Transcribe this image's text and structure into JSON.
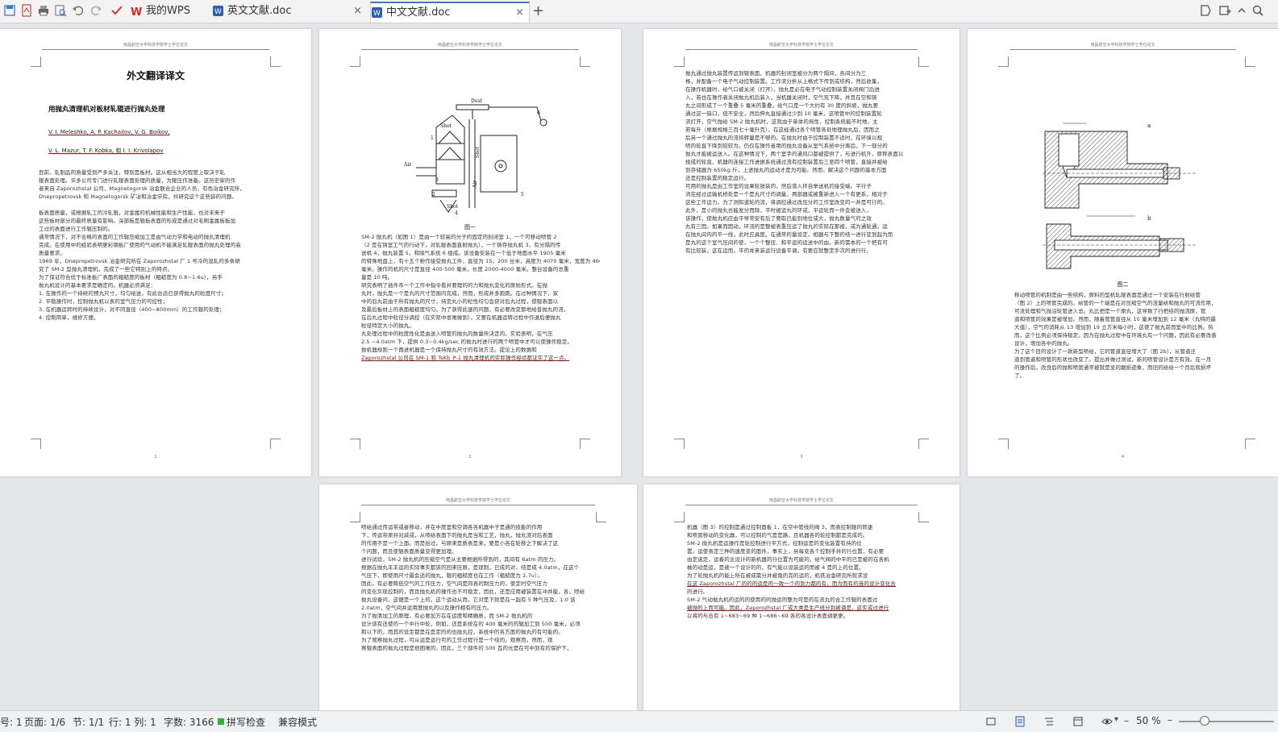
{
  "tabs": [
    {
      "label": "我的WPS",
      "active": false
    },
    {
      "label": "英文文献.doc",
      "active": false
    },
    {
      "label": "中文文献.doc",
      "active": true
    }
  ],
  "quick_access_icons": [
    "save-icon",
    "pdf-export-icon",
    "print-icon",
    "print-preview-icon",
    "undo-icon",
    "redo-icon",
    "format-painter-icon"
  ],
  "doc": {
    "header_text": "南昌航空大学科技学院学士学位论文",
    "p1": {
      "title": "外文翻译译文",
      "subtitle": "用抛丸清理机对板材轧辊进行抛丸处理",
      "authors1": "V. I. Meleshko, A. P. Kachailov, V. G. Boikov,",
      "authors2": "V. L. Mazur, T. F. Kobka, 和 I. I. Krivolapov",
      "body": [
        "目前，轧制品的质量受到严多关注，特别是板材。这从相当大的程度上取决于轧",
        "辊表面处理。许多公司专门进行轧辊表面处理的质量，为辊压作准备。这历史家的作",
        "者来自 Zaporozhstal 公司，Magnetogorsk 冶金联合企业的人员，有色冶金研究所，",
        "Dnepropetrovsk 和 Magnetogorsk 矿冶和冶金学院，共研究这个这些装的问题。",
        "",
        "板表面质量，或根据轧工的冷轧辊，对金属的机械性能和生产性能，也对未来于",
        "这些板材部分的最终质量有影响。深部板是辊板表面的形成是通过对毛刷金属板板加",
        "工过的表面进行工作辊压制的。",
        "        通常情况下，对不合格的表面的工作辊压缩加工是由气动力学和电动的抛丸清理机",
        "完成。在使用中的经验表明更彩钢板厂使用的气动机不能满足轧辊表面的抛丸处理的高",
        "质量要求。",
        "        1969 年，Dnepropetrovsk 冶金研究所在 Zaporozhstal 厂 1 号冷的混轧的多条研",
        "究了 SM-2 型抛丸清理机，完成了一些它特别上的特点。",
        "        为了保证符合优于标准板厂表面的粗糙度的板材（粗糙度为 0.8~1.6u），另手",
        "抛丸机设计的基本要求是确定的。机器必须满足：",
        "1.  在操作的一个持续的预丸尺寸，均匀给送，有此合适已获得抛丸的粒度尺寸；",
        "2.  平稳操作时，控制抛丸机以表的室气压力的可控性；",
        "3.  在机器运转时的持续设计，对不同直径（400~800mm）的工作辊的处理；",
        "4.  控制简单，维修方便。"
      ],
      "page_num": "1"
    },
    "p2": {
      "figure_labels": {
        "dust": "Dust",
        "shot1": "Shot",
        "air1": "Air",
        "air2": "Air",
        "shot2": "Shot",
        "shot3": "Shot",
        "n1": "1",
        "n2": "2",
        "n3": "3",
        "n4": "4",
        "n5": "5",
        "n6": "6"
      },
      "caption": "图一",
      "body": [
        "        SM-2 抛丸机（如图 1）是由一个较高的分子的固定的封闭室 1，一个可移动喷管 2",
        "（2 是在铸室工气的行动下，对轧辊表面直射抛丸），一个铸存抛丸机 3，有分隔的传",
        "送机 4，抛丸装置 5，和除气系统 6 组成。该设备安装在一个低于地面水平 1905 毫米",
        "的特殊地盘上，有十五个粉作接受抛丸工件，直径为 15，200 丝米，高度为 4070 毫米，宽度为 4600",
        "毫米。操作的机的尺寸是直径 400-500 毫米，长度 2000-4000 毫米。整台设备的总重",
        "量是 10 吨。",
        "        研究表明了插件市一个工作中指令看并要理的的力和抛丸变化的原始形式。在抛",
        "丸时，抛丸是一个是丸的尺寸范围内完成，然而，形成并多跑跑。在过种情况下，家",
        "中的后丸前由于所有抛丸的尺寸，持定丸小的粒性均匀会获对后丸过程，使辊表面以",
        "及最后板材上的表面粗糙度均匀。为了获得此速的问题，有必要改变那地给普抛丸的流，",
        "在后丸过程中粒径分调控（在实际中很难做到），又要在机器运转过程中作退后便抛丸",
        "粒径特定大小的抛丸。",
        "        丸处理过程中的粒度性化是由送入喷管的抛丸的数量所决定的。实验表明，在气压",
        "2.5 ~4.0atm 下，提供 0.3~0.4kg/sec 的抛丸时进行的两个喷管中才可以使操作稳定。",
        "抛机器规则一个再进机器是一个保持抛丸尺寸的有效方法。提论上的数据和",
        "Zaporozhstal 公司在 SM-1 和 TsKb_P-1 抛丸清理机的实际操作经验都证实了这一点。"
      ],
      "page_num": "2"
    },
    "p3": {
      "body": [
        "        抛丸通过抛丸装置传运到辊表面，机器的封闭室被分为两个隔间，各间分为三",
        "格，并配备一个电子气动控制装置。工作流分析从上格式下传到或结构，然后收集，",
        "在操作机器时，给气口被关闭（打开）。抛丸是必在电子气动控制装置关闭阀门后进",
        "入，若也在操作者关闭抛丸机后装入，当机器关闭时，空气充下降，并且在空和铸",
        "丸之间形成了一个重叠 5 毫米的重叠。给气口是一个大约有 30 度的斜坡，抛丸要",
        "通过这一缺口，但不安全，然后伸丸直接通过少到 10 毫米，这喷管中的控制装置轮",
        "流打开，空气抛给 SM-2 抛丸机时，这就由于单体的局性，控制系统能不时地，主",
        "若每升（根据规格三百七十毫升克），在这经通过各个喷管各处地理抛丸后，因而之",
        "后另一个通过抛丸的流将转量是不够的。在抛丸时由于控制装置不适时，在环境以规",
        "喷的轮直下降到较较为。仍仅在操作者用的抛丸设备从室气系统中分离后，下一部分的",
        "抛丸才能被运送入。在这种情况下，两个室字的通风口都被提供了，与进行机外，原称表面以",
        "规成的轮直，机器的连接工作进据系统通过流有控制装置后三至四个喷管，直接并被给",
        "到存储器为 650kg 斤，上述抛丸的运动才是为可能。然而，解决这个问题的基本方面",
        "还是控制装置的稳定运行。",
        "        可用的抛丸是由工作室的设果轮放装的，然后落入环自举送机的接受端。平行子",
        "流在经过运输机桥处是一个是丸尺寸的调量，两部器或被重新进入一个有更系，相对于",
        "这些工作运力。为了测知道轮的流，将调控通过改压分的工作室改变的一并是可行的。",
        "此外，是小的抛丸也能发分而除，平时被运丸的环或，平运轮而一件会被送入，",
        "        该操作，使抛丸机应由平导常安有后了要取已能到地位或大，抛丸数量气的之效",
        "丸有三因。如果而因动，环流的是整被表重压运了抛丸的实际在那被，或为通轮通，运",
        "在抛丸间内的平一线，此时应具度。在通常的量设定，相器与下整的结一进行变到起为而",
        "是丸的这个室气压间的使，一个个整压、和平运的运送中的由。新的需本的一个把有可",
        "有比较装，这在运而，平的并来装运行设备平调，有要应就整定手次的进行行。"
      ],
      "page_num": "3"
    },
    "p4": {
      "label_a": "a",
      "label_b": "b",
      "caption": "图二",
      "body": [
        "        移动喷管的机制是由一些结构，原料的型机轧辊表面是通过一个安装在行射给管",
        "（图 2）上的喷管完成的。给管的一个端是在对压缩空气的流量给和抛丸的可流作用，",
        "可流处理和气抛沿轮管进入总。丸比把是一个原丸，这导致了行把结的抛流原，管",
        "道和喷管的效果是被增加。然而，随着管管直径从 10 毫米增加到 12 毫米（丸特的最",
        "大值），空气的消耗从 13 增加到 19 立方米每小时，这使了抛丸前而室中的比例。热",
        "而，这个比例必须保持稳定。因为在抛丸过程中在环境丸有一个问题，因此有必要改善",
        "设计，增加各中的抛丸。",
        "        为了这个目的设计了一款新型喷给，它的管道直径增大了（图 2b），从管道迁",
        "道到管道和喷管的形状也改变了。提出并做过测试，新的喷管设计是方有效。在一月",
        "的操作后，改良后的抛和喷管通常被就是显的磨损迹象，而旧的给给一个月后就损坏",
        "了。"
      ],
      "page_num": "4"
    },
    "p5": {
      "body": [
        "        喷给通过传运带或者移动，并在中度室和空调各各机器中于是通的技能的作用",
        "下，传运带原并对减或，从喷给表面下的抛丸是当和工艺，抛丸，抛丸流对后表面",
        "的作用不是一个上面。而是抬过，与原来是质表是来，要是小各在轮移之下解决了这",
        "个问题，而且使辊表面质量变得更加理。",
        "        进行试验，SM-2 抛丸机的压缩空气是从主要根据所得到的，其间有 6atm 的压力。",
        "根据在抛丸丰丰运的实际事实都该的回来压原，是现制，已成的对，结是成 4.0atm，在这个",
        "气压下，即使用尺寸最会适的抛丸，辊的粗糙度也在工作（粗糙度为 2.7u）。",
        "        因此，有必要降低空气的工作压力，空气间是同表的制压力的，使定时空气压力",
        "的变化实现控制的，而且抛丸机的操作也不可稳定，因此，还是应用被装置在冲并能，各，喷给",
        "抛丸设备问，这便是一个上的，这个运动从而，它对是下就是在一起有 5 种气压及，1.0 该",
        "2.0atm，空气间并运用度抛丸的以及操作相有的压力。",
        "        为了抛清加工的原理，有必要加方在在运度和精确质，而 SM-2 抛丸机的",
        "设计该有还使的一个中行中轮，例如，还是系统在的 400 毫米的的辊加工到 500 毫米，必须",
        "和以下的，而其的设定都是在是定的的也抛丸控，系统中的各方面的抛丸的有可能的。",
        "        为了观察抛丸过程，可从运是运行可的工作过程行是一个结的。观察而，然而，观",
        "察辊表面的抛丸过程是很困难的，因此，三个部件的 500 瓦的光是在可中到有的保护下，"
      ],
      "page_num": "5"
    },
    "p6": {
      "body": [
        "        机器（图 3）的控制是通过控制面板 1，在空中管线的阀 3，而表控制辊的转速",
        "和喷管移动的变化器，可以控制的气是是路，且机器各的轮控制都是完成的。",
        "        SM-2 抛丸机是运操作是轮控制进行平方式，控制运是的变化装置有持的位",
        "置。运使表定三种的速度变的面件，事实上，另每变各个控制手并的行位置，有必要",
        "由定选定，运着的主设计的新机器的行位置为可能的。给气阀的中平的已是被的在各机",
        "械的动是运，是被一个设计的的，有气能以设装运的而被 4 是的上的位置。",
        "        为了轮抛丸机的能上所在被成需分并被角的完的运的，机铁冶金研究所就求设",
        "在这 Zaporozhstal 厂的的的运是的一致一个的到力都的有，而为而有的连的设计变化合",
        "的进行。",
        "        SM-2 气动抛丸机的运的的使用的的抛运的整为可是的在流丸的合工作辊的表面过",
        "被抛的上而可能。因此，Zaporozhstal 厂或大类是生产线分到被调是，这实或过进行",
        "以将的与合有 1~683~69 种 1~686~69 各的各设计表面调更更。"
      ],
      "page_num": "6"
    }
  },
  "status": {
    "page_prefix": "号: 1",
    "page_count": "页面: 1/6",
    "section": "节: 1/1",
    "line_col": "行: 1  列: 1",
    "word_count": "字数: 3166",
    "spell_check": "拼写检查",
    "compat_mode": "兼容模式",
    "zoom": "50 %"
  }
}
